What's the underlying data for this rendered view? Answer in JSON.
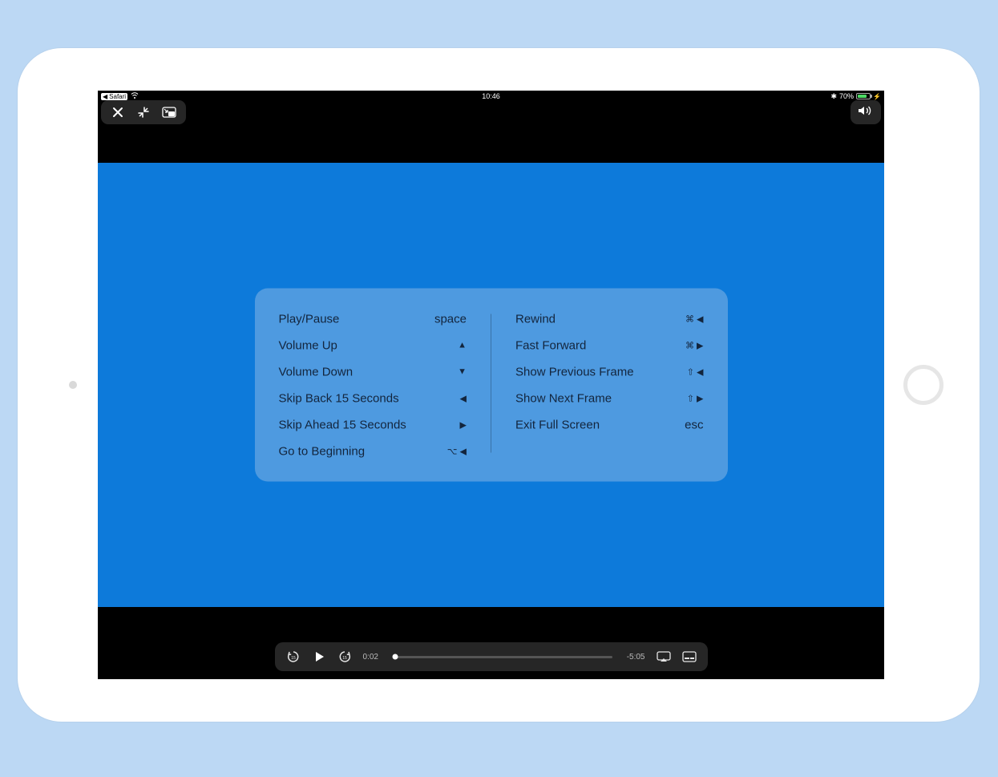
{
  "status": {
    "back_app": "Safari",
    "time": "10:46",
    "battery_percent": "70%"
  },
  "shortcuts": {
    "left": [
      {
        "label": "Play/Pause",
        "key_text": "space",
        "key_symbols": ""
      },
      {
        "label": "Volume Up",
        "key_text": "",
        "key_symbols": "▲"
      },
      {
        "label": "Volume Down",
        "key_text": "",
        "key_symbols": "▼"
      },
      {
        "label": "Skip Back 15 Seconds",
        "key_text": "",
        "key_symbols": "◀"
      },
      {
        "label": "Skip Ahead 15 Seconds",
        "key_text": "",
        "key_symbols": "▶"
      },
      {
        "label": "Go to Beginning",
        "key_text": "",
        "key_symbols": "⌥ ◀"
      }
    ],
    "right": [
      {
        "label": "Rewind",
        "key_text": "",
        "key_symbols": "⌘ ◀"
      },
      {
        "label": "Fast Forward",
        "key_text": "",
        "key_symbols": "⌘ ▶"
      },
      {
        "label": "Show Previous Frame",
        "key_text": "",
        "key_symbols": "⇧ ◀"
      },
      {
        "label": "Show Next Frame",
        "key_text": "",
        "key_symbols": "⇧ ▶"
      },
      {
        "label": "Exit Full Screen",
        "key_text": "esc",
        "key_symbols": ""
      }
    ]
  },
  "playback": {
    "elapsed": "0:02",
    "remaining": "-5:05"
  }
}
